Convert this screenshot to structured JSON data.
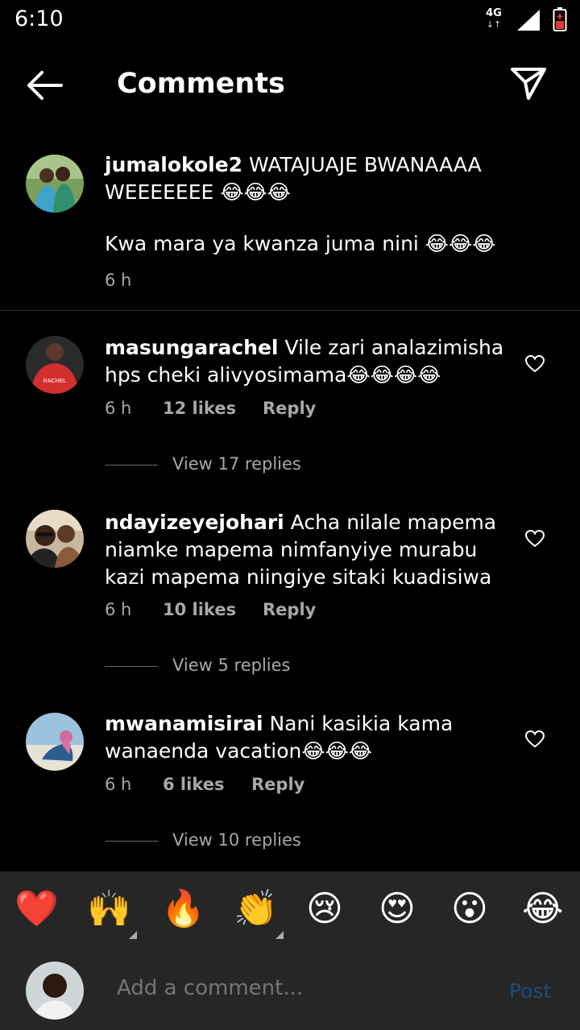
{
  "status_bar": {
    "time": "6:10",
    "network": "4G",
    "network_arrows": "↓↑"
  },
  "header": {
    "title": "Comments"
  },
  "caption": {
    "username": "jumalokole2",
    "text_line1": " WATAJUAJE BWANAAAA",
    "text_line2": "WEEEEEEE 😂😂😂",
    "text_line3": "Kwa mara ya kwanza juma nini 😂😂😂",
    "time": "6 h"
  },
  "comments": [
    {
      "username": "masungarachel",
      "line1": " Vile zari analazimisha",
      "line2": "hps cheki alivyosimama😂😂😂😂",
      "line3": "",
      "time": "6 h",
      "likes": "12 likes",
      "reply": "Reply",
      "view_replies": "View 17 replies"
    },
    {
      "username": "ndayizeyejohari",
      "line1": " Acha nilale mapema",
      "line2": "niamke mapema nimfanyiye murabu",
      "line3": "kazi mapema niingiye sitaki kuadisiwa",
      "time": "6 h",
      "likes": "10 likes",
      "reply": "Reply",
      "view_replies": "View 5 replies"
    },
    {
      "username": "mwanamisirai",
      "line1": " Nani kasikia kama",
      "line2": "wanaenda vacation😂😂😂",
      "line3": "",
      "time": "6 h",
      "likes": "6 likes",
      "reply": "Reply",
      "view_replies": "View 10 replies"
    }
  ],
  "emoji_bar": [
    "❤️",
    "🙌",
    "🔥",
    "👏",
    "😢",
    "😍",
    "😮",
    "😂"
  ],
  "composer": {
    "placeholder": "Add a comment...",
    "post_label": "Post"
  },
  "colors": {
    "background": "#000000",
    "muted": "#a8a8a8",
    "post_disabled": "#1d4c78",
    "panel": "#262626"
  }
}
